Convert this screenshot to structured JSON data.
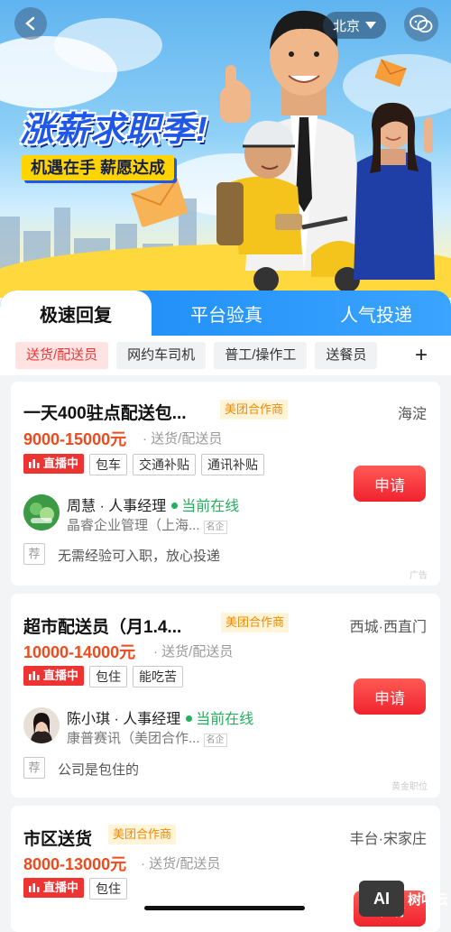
{
  "header": {
    "city": "北京",
    "headline": "涨薪求职季!",
    "tagline": "机遇在手 薪愿达成"
  },
  "tabs": [
    {
      "label": "极速回复",
      "active": true
    },
    {
      "label": "平台验真",
      "active": false
    },
    {
      "label": "人气投递",
      "active": false
    }
  ],
  "filters": [
    {
      "label": "送货/配送员",
      "active": true
    },
    {
      "label": "网约车司机",
      "active": false
    },
    {
      "label": "普工/操作工",
      "active": false
    },
    {
      "label": "送餐员",
      "active": false
    }
  ],
  "filters_more": "+",
  "jobs": [
    {
      "title": "一天400驻点配送包...",
      "partner": "美团合作商",
      "location": "海淀",
      "salary": "9000-15000元",
      "category": "送货/配送员",
      "live": "直播中",
      "tags": [
        "包车",
        "交通补贴",
        "通讯补贴"
      ],
      "apply": "申请",
      "recruiter": "周慧 · 人事经理",
      "status": "当前在线",
      "company": "晶睿企业管理（上海...",
      "company_badge": "名企",
      "rec_mark": "荐",
      "recommend": "无需经验可入职，放心投递",
      "corner": "广告"
    },
    {
      "title": "超市配送员（月1.4...",
      "partner": "美团合作商",
      "location": "西城·西直门",
      "salary": "10000-14000元",
      "category": "送货/配送员",
      "live": "直播中",
      "tags": [
        "包住",
        "能吃苦"
      ],
      "apply": "申请",
      "recruiter": "陈小琪 · 人事经理",
      "status": "当前在线",
      "company": "康普赛讯（美团合作...",
      "company_badge": "名企",
      "rec_mark": "荐",
      "recommend": "公司是包住的",
      "corner": "黄金职位"
    },
    {
      "title": "市区送货",
      "partner": "美团合作商",
      "location": "丰台·宋家庄",
      "salary": "8000-13000元",
      "category": "送货/配送员",
      "live": "直播中",
      "tags": [
        "包住"
      ],
      "apply": "申请"
    }
  ],
  "watermark": {
    "logo": "AI",
    "text": "树叶云"
  },
  "colors": {
    "accent": "#1787f5",
    "salary": "#f04a1d",
    "apply": "#f0222e",
    "online": "#23b05c",
    "live": "#ee3333"
  }
}
